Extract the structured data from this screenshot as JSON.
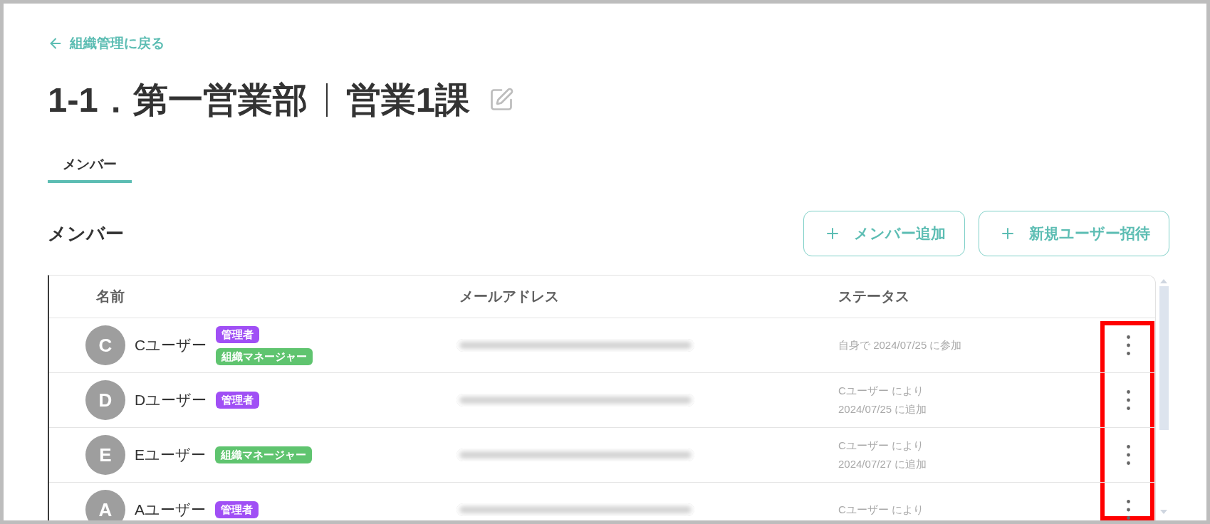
{
  "back_link": {
    "label": "組織管理に戻る"
  },
  "title": {
    "department": "1-1．第一営業部",
    "section": "営業1課"
  },
  "tabs": [
    {
      "label": "メンバー",
      "selected": true
    }
  ],
  "members_panel": {
    "heading": "メンバー",
    "buttons": [
      {
        "label": "メンバー追加"
      },
      {
        "label": "新規ユーザー招待"
      }
    ]
  },
  "table": {
    "columns": [
      "名前",
      "メールアドレス",
      "ステータス"
    ],
    "highlight_actions": true,
    "rows": [
      {
        "initial": "C",
        "name": "Cユーザー",
        "badges": [
          {
            "label": "管理者",
            "color": "#a04ff5"
          },
          {
            "label": "組織マネージャー",
            "color": "#5fc46f"
          }
        ],
        "email_redacted": true,
        "status": [
          "自身で 2024/07/25 に参加"
        ]
      },
      {
        "initial": "D",
        "name": "Dユーザー",
        "badges": [
          {
            "label": "管理者",
            "color": "#a04ff5"
          }
        ],
        "email_redacted": true,
        "status": [
          "Cユーザー により",
          "2024/07/25 に追加"
        ]
      },
      {
        "initial": "E",
        "name": "Eユーザー",
        "badges": [
          {
            "label": "組織マネージャー",
            "color": "#5fc46f"
          }
        ],
        "email_redacted": true,
        "status": [
          "Cユーザー により",
          "2024/07/27 に追加"
        ]
      },
      {
        "initial": "A",
        "name": "Aユーザー",
        "badges": [
          {
            "label": "管理者",
            "color": "#a04ff5"
          }
        ],
        "email_redacted": true,
        "status": [
          "Cユーザー により"
        ]
      }
    ]
  }
}
